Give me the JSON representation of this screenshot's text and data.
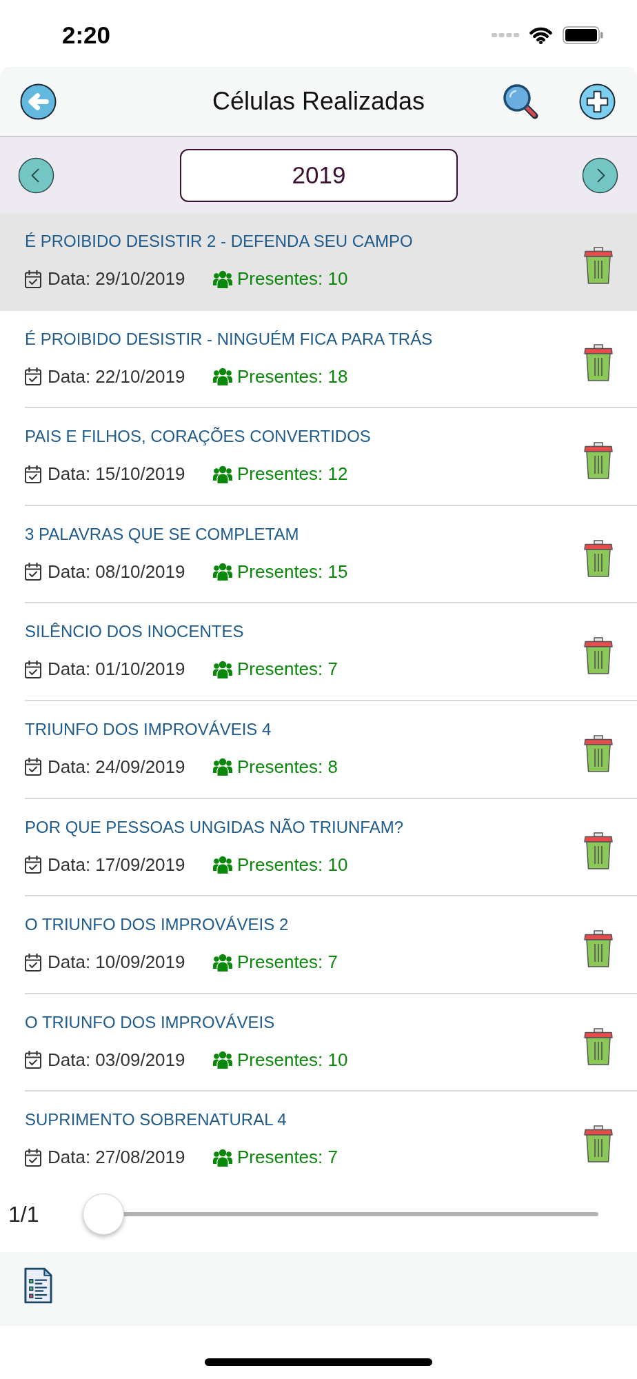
{
  "status_bar": {
    "time": "2:20"
  },
  "navigation_bar": {
    "title": "Células Realizadas"
  },
  "year_selector": {
    "year": "2019"
  },
  "meetings": [
    {
      "title": "É PROIBIDO DESISTIR 2 - DEFENDA SEU CAMPO",
      "date": "Data: 29/10/2019",
      "attendance": "Presentes: 10",
      "selected": true
    },
    {
      "title": "É PROIBIDO DESISTIR - NINGUÉM FICA PARA TRÁS",
      "date": "Data: 22/10/2019",
      "attendance": "Presentes: 18",
      "selected": false
    },
    {
      "title": "PAIS E FILHOS, CORAÇÕES CONVERTIDOS",
      "date": "Data: 15/10/2019",
      "attendance": "Presentes: 12",
      "selected": false
    },
    {
      "title": "3 PALAVRAS QUE SE COMPLETAM",
      "date": "Data: 08/10/2019",
      "attendance": "Presentes: 15",
      "selected": false
    },
    {
      "title": "SILÊNCIO DOS INOCENTES",
      "date": "Data: 01/10/2019",
      "attendance": "Presentes: 7",
      "selected": false
    },
    {
      "title": "TRIUNFO DOS IMPROVÁVEIS 4",
      "date": "Data: 24/09/2019",
      "attendance": "Presentes: 8",
      "selected": false
    },
    {
      "title": "POR QUE PESSOAS UNGIDAS NÃO TRIUNFAM?",
      "date": "Data: 17/09/2019",
      "attendance": "Presentes: 10",
      "selected": false
    },
    {
      "title": "O TRIUNFO DOS IMPROVÁVEIS 2",
      "date": "Data: 10/09/2019",
      "attendance": "Presentes: 7",
      "selected": false
    },
    {
      "title": "O TRIUNFO DOS IMPROVÁVEIS",
      "date": "Data: 03/09/2019",
      "attendance": "Presentes: 10",
      "selected": false
    },
    {
      "title": "SUPRIMENTO SOBRENATURAL 4",
      "date": "Data: 27/08/2019",
      "attendance": "Presentes: 7",
      "selected": false
    }
  ],
  "pager": {
    "label": "1/1",
    "level": 0
  }
}
